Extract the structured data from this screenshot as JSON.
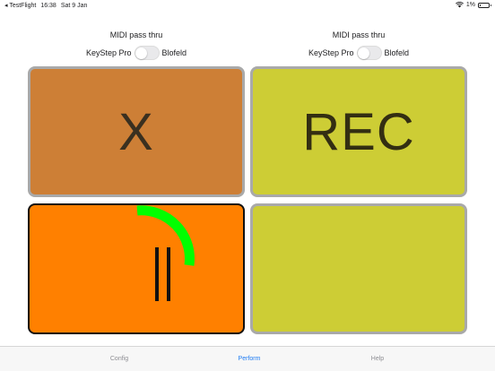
{
  "status_bar": {
    "back_app": "TestFlight",
    "time": "16:38",
    "date": "Sat 9 Jan",
    "battery": "1%",
    "battery_level": 0.01
  },
  "midi_groups": [
    {
      "title": "MIDI pass thru",
      "left_label": "KeyStep Pro",
      "right_label": "Blofeld",
      "on": false
    },
    {
      "title": "MIDI pass thru",
      "left_label": "KeyStep Pro",
      "right_label": "Blofeld",
      "on": false
    }
  ],
  "pads": {
    "x": {
      "label": "X",
      "color": "#cd7f36"
    },
    "rec": {
      "label": "REC",
      "color": "#cdcd35"
    },
    "pause": {
      "label": "II",
      "color": "#ff8000",
      "progress_color": "#00ff00"
    },
    "empty": {
      "label": "",
      "color": "#cdcd35"
    }
  },
  "tabs": [
    {
      "label": "Config",
      "active": false
    },
    {
      "label": "Perform",
      "active": true
    },
    {
      "label": "Help",
      "active": false
    }
  ],
  "colors": {
    "accent": "#1f7cf3",
    "pad_border": "#a9a9a9"
  }
}
